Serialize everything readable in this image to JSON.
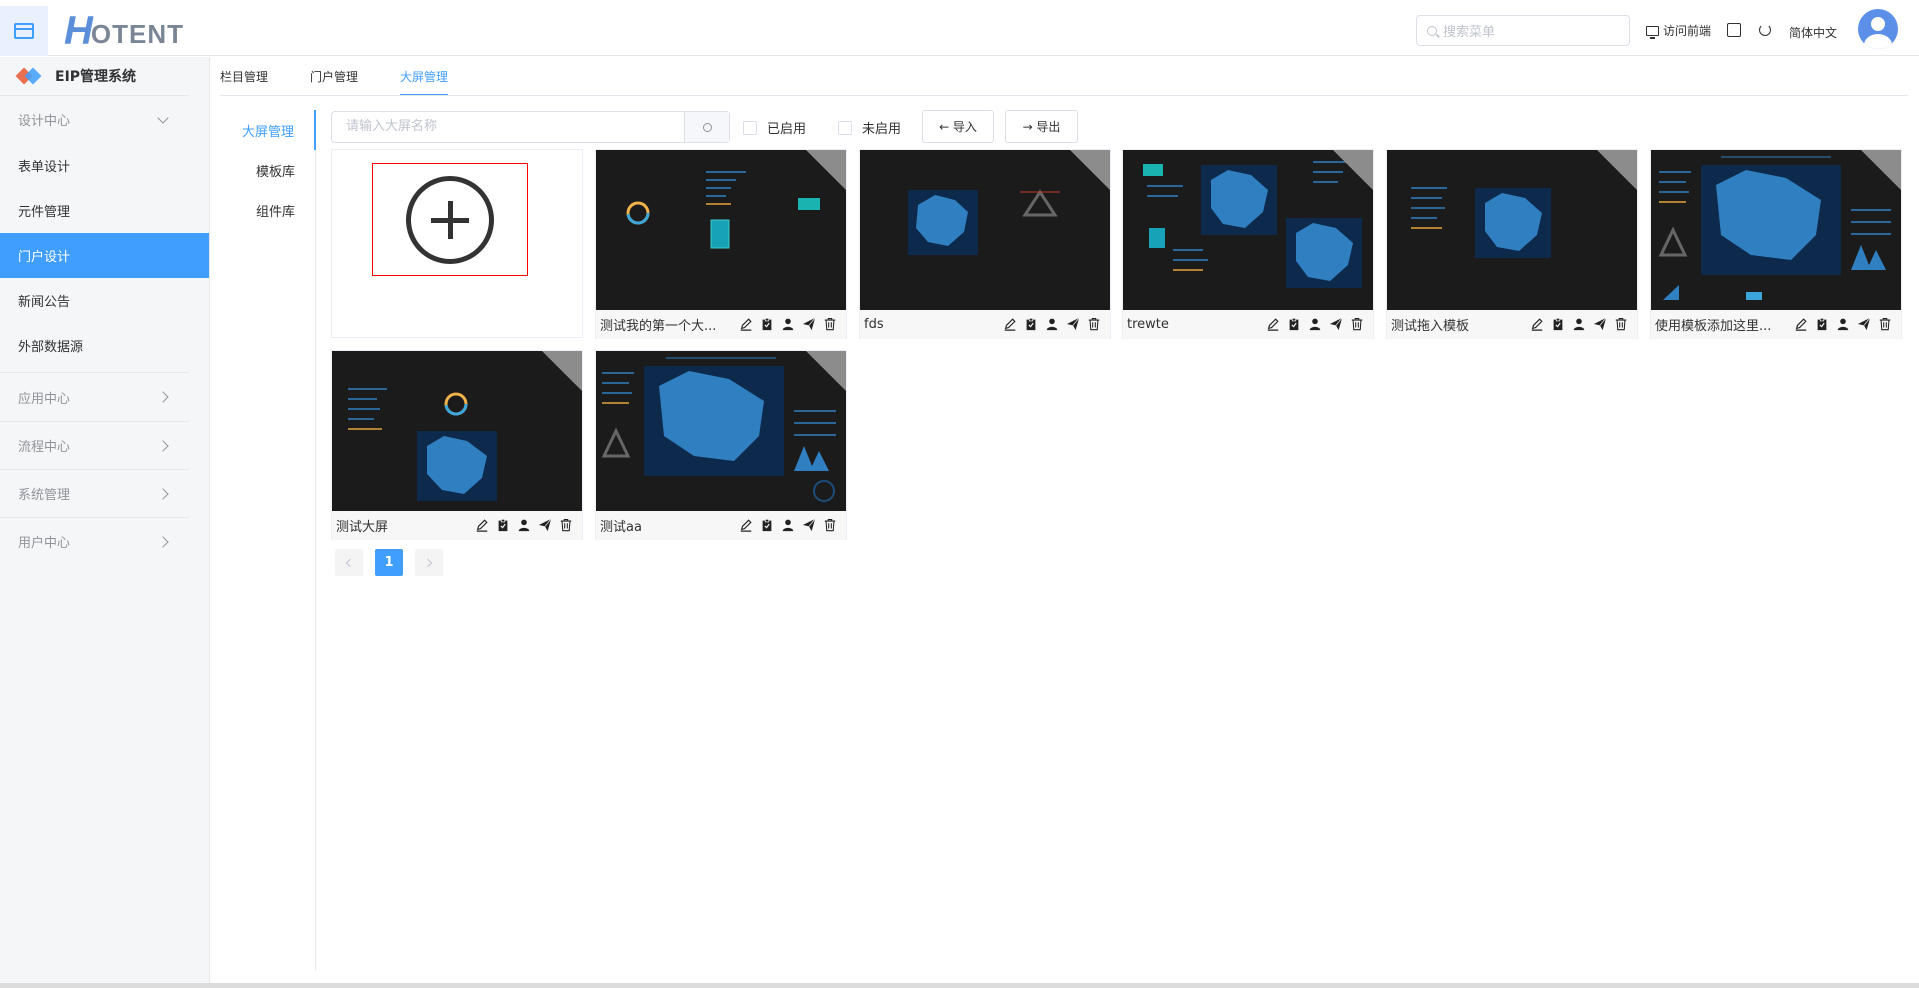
{
  "header": {
    "logo_letter": "H",
    "logo_rest": "OTENT",
    "search_placeholder": "搜索菜单",
    "visit_frontend": "访问前端",
    "language": "简体中文"
  },
  "sidebar": {
    "system_title": "EIP管理系统",
    "groups": [
      {
        "label": "设计中心",
        "expanded": true
      },
      {
        "label": "应用中心",
        "expanded": false
      },
      {
        "label": "流程中心",
        "expanded": false
      },
      {
        "label": "系统管理",
        "expanded": false
      },
      {
        "label": "用户中心",
        "expanded": false
      }
    ],
    "items": [
      {
        "label": "表单设计"
      },
      {
        "label": "元件管理"
      },
      {
        "label": "门户设计",
        "active": true
      },
      {
        "label": "新闻公告"
      },
      {
        "label": "外部数据源"
      }
    ]
  },
  "tabs": [
    {
      "label": "栏目管理"
    },
    {
      "label": "门户管理"
    },
    {
      "label": "大屏管理",
      "active": true
    }
  ],
  "subnav": [
    {
      "label": "大屏管理",
      "active": true
    },
    {
      "label": "模板库"
    },
    {
      "label": "组件库"
    }
  ],
  "toolbar": {
    "search_placeholder": "请输入大屏名称",
    "enabled_label": "已启用",
    "disabled_label": "未启用",
    "import_label": "← 导入",
    "export_label": "→ 导出"
  },
  "cards": [
    {
      "name": "测试我的第一个大..."
    },
    {
      "name": "fds"
    },
    {
      "name": "trewte"
    },
    {
      "name": "测试拖入模板"
    },
    {
      "name": "使用模板添加这里..."
    },
    {
      "name": "测试大屏"
    },
    {
      "name": "测试aa"
    }
  ],
  "pagination": {
    "current": "1"
  },
  "colors": {
    "accent": "#409eff",
    "thumb_bg": "#1b1b1b",
    "map_blue": "#2f7fc1"
  }
}
